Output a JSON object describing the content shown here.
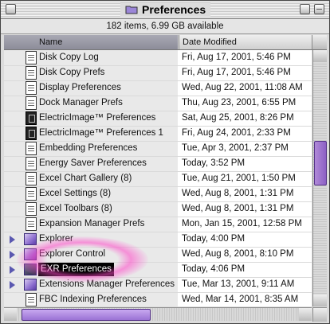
{
  "window": {
    "title": "Preferences",
    "status": "182 items, 6.99 GB available"
  },
  "columns": {
    "name": "Name",
    "date": "Date Modified"
  },
  "rows": [
    {
      "name": "Disk Copy Log",
      "date": "Fri, Aug 17, 2001, 5:46 PM",
      "icon": "document-icon",
      "folder": false
    },
    {
      "name": "Disk Copy Prefs",
      "date": "Fri, Aug 17, 2001, 5:46 PM",
      "icon": "document-icon",
      "folder": false
    },
    {
      "name": "Display Preferences",
      "date": "Wed, Aug 22, 2001, 11:08 AM",
      "icon": "document-icon",
      "folder": false
    },
    {
      "name": "Dock Manager Prefs",
      "date": "Thu, Aug 23, 2001, 6:55 PM",
      "icon": "document-icon",
      "folder": false
    },
    {
      "name": "ElectricImage™ Preferences",
      "date": "Sat, Aug 25, 2001, 8:26 PM",
      "icon": "electricimage-icon",
      "folder": false
    },
    {
      "name": "ElectricImage™ Preferences 1",
      "date": "Fri, Aug 24, 2001, 2:33 PM",
      "icon": "electricimage-icon",
      "folder": false
    },
    {
      "name": "Embedding Preferences",
      "date": "Tue, Apr 3, 2001, 2:37 PM",
      "icon": "document-icon",
      "folder": false
    },
    {
      "name": "Energy Saver Preferences",
      "date": "Today, 3:52 PM",
      "icon": "document-icon",
      "folder": false
    },
    {
      "name": "Excel Chart Gallery (8)",
      "date": "Tue, Aug 21, 2001, 1:50 PM",
      "icon": "document-icon",
      "folder": false
    },
    {
      "name": "Excel Settings (8)",
      "date": "Wed, Aug 8, 2001, 1:31 PM",
      "icon": "document-icon",
      "folder": false
    },
    {
      "name": "Excel Toolbars (8)",
      "date": "Wed, Aug 8, 2001, 1:31 PM",
      "icon": "document-icon",
      "folder": false
    },
    {
      "name": "Expansion Manager Prefs",
      "date": "Mon, Jan 15, 2001, 12:58 PM",
      "icon": "document-icon",
      "folder": false
    },
    {
      "name": "Explorer",
      "date": "Today, 4:00 PM",
      "icon": "folder-icon",
      "folder": true
    },
    {
      "name": "Explorer Control",
      "date": "Wed, Aug 8, 2001, 8:10 PM",
      "icon": "folder-icon",
      "folder": true
    },
    {
      "name": "EXR Preferences",
      "date": "Today, 4:06 PM",
      "icon": "folder-icon",
      "folder": true,
      "selected": true
    },
    {
      "name": "Extensions Manager Preferences",
      "date": "Tue, Mar 13, 2001, 9:11 AM",
      "icon": "folder-icon",
      "folder": true
    },
    {
      "name": "FBC Indexing Preferences",
      "date": "Wed, Mar 14, 2001, 8:35 AM",
      "icon": "document-icon",
      "folder": false
    }
  ],
  "colors": {
    "selection_highlight": "#ff46c8",
    "scrollbar_thumb": "#8c5fc4",
    "disclosure_triangle": "#5a58b0"
  }
}
